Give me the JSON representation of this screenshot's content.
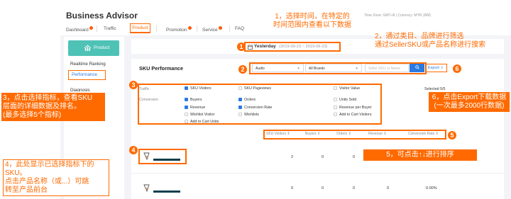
{
  "app": {
    "title": "Business Advisor",
    "timezone": "Time Zone: GMT+8 | Currency: MYR (RM)"
  },
  "nav": {
    "dashboard": "Dashboard",
    "traffic": "Traffic",
    "product": "Product",
    "promotion": "Promotion",
    "service": "Service",
    "faq": "FAQ"
  },
  "sidebar": {
    "header": "Product",
    "items": [
      "Realtime Ranking",
      "Performance",
      "Diagnosis"
    ]
  },
  "date_filter": {
    "label": "Yesterday",
    "range": "(2019-09-23 ~ 2019-09-23)"
  },
  "sku_panel": {
    "title": "SKU Performance",
    "category_value": "Audio",
    "brand_value": "All Brands",
    "search_placeholder": "Seller SKU or Name",
    "export_label": "Export"
  },
  "metrics": {
    "traffic_label": "Traffic",
    "conversion_label": "Conversion",
    "selected_text": "Selected 5/5",
    "traffic_items": [
      {
        "label": "SKU Visitors",
        "checked": true
      },
      {
        "label": "SKU Pageviews",
        "checked": false
      },
      {
        "label": "Visitor Value",
        "checked": false
      }
    ],
    "conversion_items": [
      {
        "label": "Buyers",
        "checked": true
      },
      {
        "label": "Orders",
        "checked": true
      },
      {
        "label": "Units Sold",
        "checked": false
      },
      {
        "label": "Revenue",
        "checked": true
      },
      {
        "label": "Conversion Rate",
        "checked": true
      },
      {
        "label": "Revenue per Buyer",
        "checked": false
      },
      {
        "label": "Wishlist Visitor",
        "checked": false
      },
      {
        "label": "Wishlists",
        "checked": false
      },
      {
        "label": "Add to Cart Visitors",
        "checked": false
      },
      {
        "label": "Add to Cart Units",
        "checked": false
      }
    ]
  },
  "table": {
    "columns": [
      "SKU Visitors",
      "Buyers",
      "Orders",
      "Revenue",
      "Conversion Rate"
    ],
    "rows": [
      {
        "sku_visitors": "2",
        "buyers": "0",
        "orders": "0",
        "revenue": "",
        "conversion_rate": ""
      },
      {
        "sku_visitors": "0",
        "buyers": "0",
        "orders": "0",
        "revenue": "0",
        "conversion_rate": "0.00%"
      }
    ]
  },
  "annotations": {
    "a1_num": "1",
    "a1_line1": "1，选择时间，在特定的",
    "a1_line2": "时间范围内查看以下数据",
    "a2_num": "2",
    "a2_line1": "2，通过类目、品牌进行筛选",
    "a2_line2": "通过SellerSKU或产品名称进行搜索",
    "a3_num": "3",
    "a3_line1": "3，点击选择指标，查看SKU",
    "a3_line2": "层面的详细数据及排名。",
    "a3_line3": "(最多选择5个指标)",
    "a4_num": "4",
    "a4_line1": "4，此处显示已选择指标下的",
    "a4_line2": "SKU。",
    "a4_line3": "点击产品名称（或...）可跳",
    "a4_line4": "转至产品前台",
    "a5_num": "5",
    "a5_line1": "5，可点击↑↓进行排序",
    "a6_num": "6",
    "a6_line1": "6，点击Export下载数据",
    "a6_line2": "(一次最多2000行数据)"
  }
}
